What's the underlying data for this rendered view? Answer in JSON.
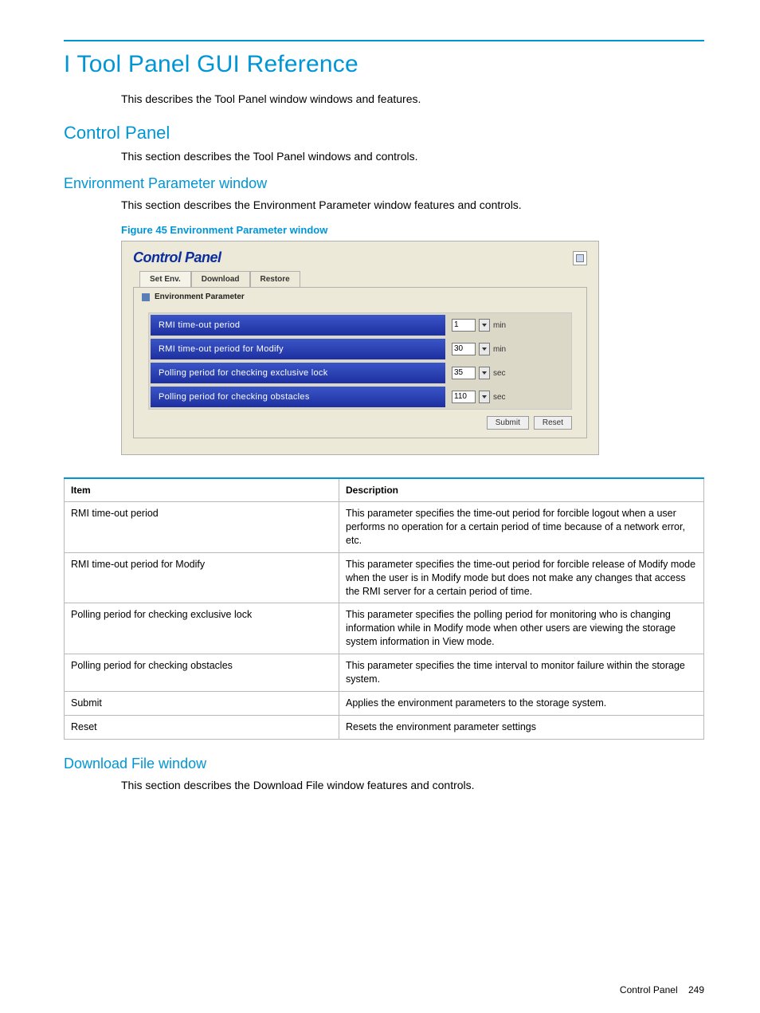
{
  "headings": {
    "appendix": "I Tool Panel GUI Reference",
    "appendix_intro": "This describes the Tool Panel window windows and features.",
    "section1": "Control Panel",
    "section1_intro": "This section describes the Tool Panel windows and controls.",
    "subsection1": "Environment Parameter window",
    "subsection1_intro": "This section describes the Environment Parameter window features and controls.",
    "figure_caption": "Figure 45 Environment Parameter window",
    "subsection2": "Download File window",
    "subsection2_intro": "This section describes the Download File window features and controls."
  },
  "panel": {
    "title": "Control Panel",
    "tabs": {
      "t0": "Set Env.",
      "t1": "Download",
      "t2": "Restore"
    },
    "env_header": "Environment Parameter",
    "rows": {
      "r0": {
        "label": "RMI time-out period",
        "value": "1",
        "unit": "min"
      },
      "r1": {
        "label": "RMI time-out period for Modify",
        "value": "30",
        "unit": "min"
      },
      "r2": {
        "label": "Polling period for checking exclusive lock",
        "value": "35",
        "unit": "sec"
      },
      "r3": {
        "label": "Polling period for checking obstacles",
        "value": "110",
        "unit": "sec"
      }
    },
    "buttons": {
      "submit": "Submit",
      "reset": "Reset"
    }
  },
  "table": {
    "head": {
      "item": "Item",
      "desc": "Description"
    },
    "rows": {
      "r0": {
        "item": "RMI time-out period",
        "desc": "This parameter specifies the time-out period for forcible logout when a user performs no operation for a certain period of time because of a network error, etc."
      },
      "r1": {
        "item": "RMI time-out period for Modify",
        "desc": "This parameter specifies the time-out period for forcible release of Modify mode when the user is in Modify mode but does not make any changes that access the RMI server for a certain period of time."
      },
      "r2": {
        "item": "Polling period for checking exclusive lock",
        "desc": "This parameter specifies the polling period for monitoring who is changing information while in Modify mode when other users are viewing the storage system information in View mode."
      },
      "r3": {
        "item": "Polling period for checking obstacles",
        "desc": "This parameter specifies the time interval to monitor failure within the storage system."
      },
      "r4": {
        "item": "Submit",
        "desc": "Applies the environment parameters to the storage system."
      },
      "r5": {
        "item": "Reset",
        "desc": "Resets the environment parameter settings"
      }
    }
  },
  "footer": {
    "label": "Control Panel",
    "page": "249"
  }
}
